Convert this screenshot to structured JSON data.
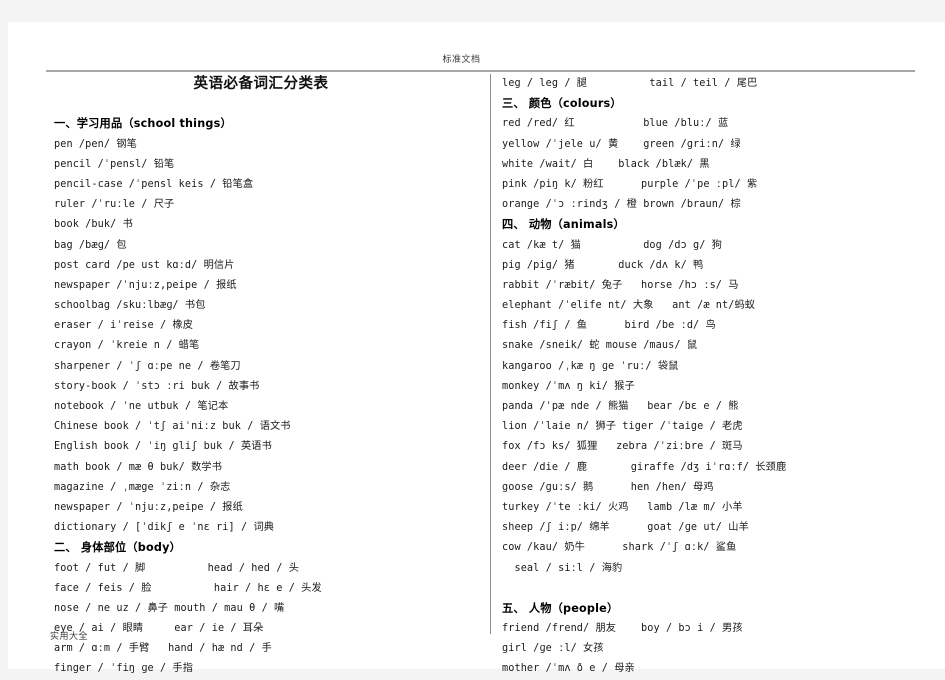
{
  "page": {
    "header_watermark": "标准文档",
    "footer_watermark": "实用大全",
    "title": "英语必备词汇分类表"
  },
  "left_column": [
    {
      "type": "spacer",
      "text": ""
    },
    {
      "type": "spacer",
      "text": ""
    },
    {
      "type": "heading",
      "text": "一、学习用品（school things）"
    },
    {
      "type": "entry",
      "text": "pen /pen/ 钢笔"
    },
    {
      "type": "entry",
      "text": "pencil /ˈpensl/ 铅笔"
    },
    {
      "type": "entry",
      "text": "pencil-case /ˈpensl keis / 铅笔盒"
    },
    {
      "type": "entry",
      "text": "ruler /ˈruːle / 尺子"
    },
    {
      "type": "entry",
      "text": "book /buk/ 书"
    },
    {
      "type": "entry",
      "text": "bag /bæɡ/ 包"
    },
    {
      "type": "entry",
      "text": "post card /pe ust kɑːd/ 明信片"
    },
    {
      "type": "entry",
      "text": "newspaper /ˈnjuːz,peipe / 报纸"
    },
    {
      "type": "entry",
      "text": "schoolbag /skuːlbæɡ/ 书包"
    },
    {
      "type": "entry",
      "text": "eraser / iˈreise / 橡皮"
    },
    {
      "type": "entry",
      "text": "crayon / ˈkreie n / 蜡笔"
    },
    {
      "type": "entry",
      "text": "sharpener / ˈʃ ɑːpe ne / 卷笔刀"
    },
    {
      "type": "entry",
      "text": "story-book / ˈstɔ ːri buk / 故事书"
    },
    {
      "type": "entry",
      "text": "notebook / ˈne utbuk / 笔记本"
    },
    {
      "type": "entry",
      "text": "Chinese book / ˈtʃ aiˈniːz buk / 语文书"
    },
    {
      "type": "entry",
      "text": "English book / ˈiŋ gliʃ buk / 英语书"
    },
    {
      "type": "entry",
      "text": "math book / mæ θ buk/ 数学书"
    },
    {
      "type": "entry",
      "text": "magazine / ˌmæge ˈziːn / 杂志"
    },
    {
      "type": "entry",
      "text": "newspaper / ˈnjuːz,peipe / 报纸"
    },
    {
      "type": "entry",
      "text": "dictionary / [ˈdikʃ e ˈnɛ ri] / 词典"
    },
    {
      "type": "heading",
      "text": "二、 身体部位（body）"
    },
    {
      "type": "entry",
      "text": "foot / fut / 脚          head / hed / 头"
    },
    {
      "type": "entry",
      "text": "face / feis / 脸          hair / hɛ e / 头发"
    },
    {
      "type": "entry",
      "text": "nose / ne uz / 鼻子 mouth / mau θ / 嘴"
    },
    {
      "type": "entry",
      "text": "eye / ai / 眼睛     ear / ie / 耳朵"
    },
    {
      "type": "entry",
      "text": "arm / ɑːm / 手臂   hand / hæ nd / 手"
    },
    {
      "type": "entry",
      "text": "finger / ˈfiŋ ɡe / 手指"
    }
  ],
  "right_column": [
    {
      "type": "entry",
      "text": "leg / leg / 腿          tail / teil / 尾巴"
    },
    {
      "type": "heading",
      "text": "三、 颜色（colours）"
    },
    {
      "type": "entry",
      "text": "red /red/ 红           blue /bluː/ 蓝"
    },
    {
      "type": "entry",
      "text": "yellow /ˈjele u/ 黄    green /griːn/ 绿"
    },
    {
      "type": "entry",
      "text": "white /wait/ 白    black /blæk/ 黑"
    },
    {
      "type": "entry",
      "text": "pink /piŋ k/ 粉红      purple /ˈpe ːpl/ 紫"
    },
    {
      "type": "entry",
      "text": "orange /ˈɔ ːrindʒ / 橙 brown /braun/ 棕"
    },
    {
      "type": "heading",
      "text": "四、 动物（animals）"
    },
    {
      "type": "entry",
      "text": "cat /kæ t/ 猫          dog /dɔ g/ 狗"
    },
    {
      "type": "entry",
      "text": "pig /pig/ 猪       duck /dʌ k/ 鸭"
    },
    {
      "type": "entry",
      "text": "rabbit /ˈræbit/ 兔子   horse /hɔ ːs/ 马"
    },
    {
      "type": "entry",
      "text": "elephant /ˈelife nt/ 大象   ant /æ nt/蚂蚁"
    },
    {
      "type": "entry",
      "text": "fish /fiʃ / 鱼      bird /be ːd/ 鸟"
    },
    {
      "type": "entry",
      "text": "snake /sneik/ 蛇 mouse /maus/ 鼠"
    },
    {
      "type": "entry",
      "text": "kangaroo /ˌkæ ŋ ɡe ˈruː/ 袋鼠"
    },
    {
      "type": "entry",
      "text": "monkey /ˈmʌ ŋ ki/ 猴子"
    },
    {
      "type": "entry",
      "text": "panda /ˈpæ nde / 熊猫   bear /bɛ e / 熊"
    },
    {
      "type": "entry",
      "text": "lion /ˈlaie n/ 狮子 tiger /ˈtaige / 老虎"
    },
    {
      "type": "entry",
      "text": "fox /fɔ ks/ 狐狸   zebra /ˈziːbre / 斑马"
    },
    {
      "type": "entry",
      "text": "deer /die / 鹿       giraffe /dʒ iˈrɑːf/ 长颈鹿"
    },
    {
      "type": "entry",
      "text": "goose /guːs/ 鹅      hen /hen/ 母鸡"
    },
    {
      "type": "entry",
      "text": "turkey /ˈte ːki/ 火鸡   lamb /læ m/ 小羊"
    },
    {
      "type": "entry",
      "text": "sheep /ʃ iːp/ 绵羊      goat /ɡe ut/ 山羊"
    },
    {
      "type": "entry",
      "text": "cow /kau/ 奶牛      shark /ˈʃ ɑːk/ 鲨鱼"
    },
    {
      "type": "entry",
      "text": "  seal / siːl / 海豹"
    },
    {
      "type": "spacer",
      "text": ""
    },
    {
      "type": "heading",
      "text": "五、 人物（people）"
    },
    {
      "type": "entry",
      "text": "friend /frend/ 朋友    boy / bɔ i / 男孩"
    },
    {
      "type": "entry",
      "text": "girl /ɡe ːl/ 女孩"
    },
    {
      "type": "entry",
      "text": "mother /ˈmʌ ð e / 母亲"
    }
  ]
}
